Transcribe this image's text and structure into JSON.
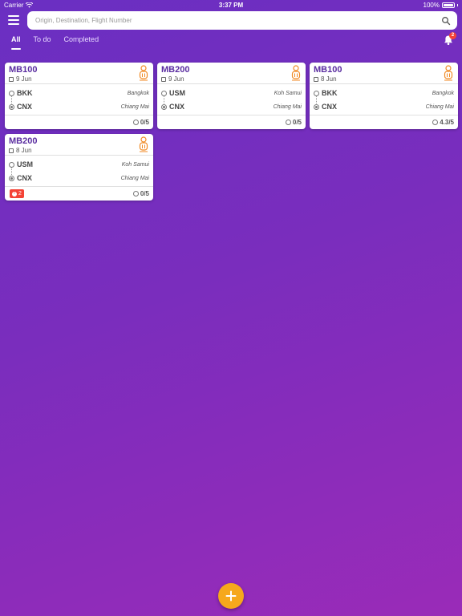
{
  "status": {
    "carrier": "Carrier",
    "time": "3:37 PM",
    "battery": "100%"
  },
  "search": {
    "placeholder": "Origin, Destination, Flight Number"
  },
  "tabs": [
    {
      "label": "All"
    },
    {
      "label": "To do"
    },
    {
      "label": "Completed"
    }
  ],
  "notifications": {
    "count": "2"
  },
  "cards": [
    {
      "flight": "MB100",
      "date": "9 Jun",
      "origin": {
        "code": "BKK",
        "city": "Bangkok"
      },
      "dest": {
        "code": "CNX",
        "city": "Chiang Mai"
      },
      "rating": "0/5",
      "alert": ""
    },
    {
      "flight": "MB200",
      "date": "9 Jun",
      "origin": {
        "code": "USM",
        "city": "Koh Samui"
      },
      "dest": {
        "code": "CNX",
        "city": "Chiang Mai"
      },
      "rating": "0/5",
      "alert": ""
    },
    {
      "flight": "MB100",
      "date": "8 Jun",
      "origin": {
        "code": "BKK",
        "city": "Bangkok"
      },
      "dest": {
        "code": "CNX",
        "city": "Chiang Mai"
      },
      "rating": "4.3/5",
      "alert": ""
    },
    {
      "flight": "MB200",
      "date": "8 Jun",
      "origin": {
        "code": "USM",
        "city": "Koh Samui"
      },
      "dest": {
        "code": "CNX",
        "city": "Chiang Mai"
      },
      "rating": "0/5",
      "alert": "2"
    }
  ],
  "colors": {
    "accent": "#5a2da0",
    "fab": "#f6a81c",
    "alert": "#f44336",
    "logo": "#f08a24"
  },
  "icons": {
    "menu": "hamburger-icon",
    "search": "search-icon",
    "bell": "bell-icon",
    "add": "plus-icon"
  }
}
